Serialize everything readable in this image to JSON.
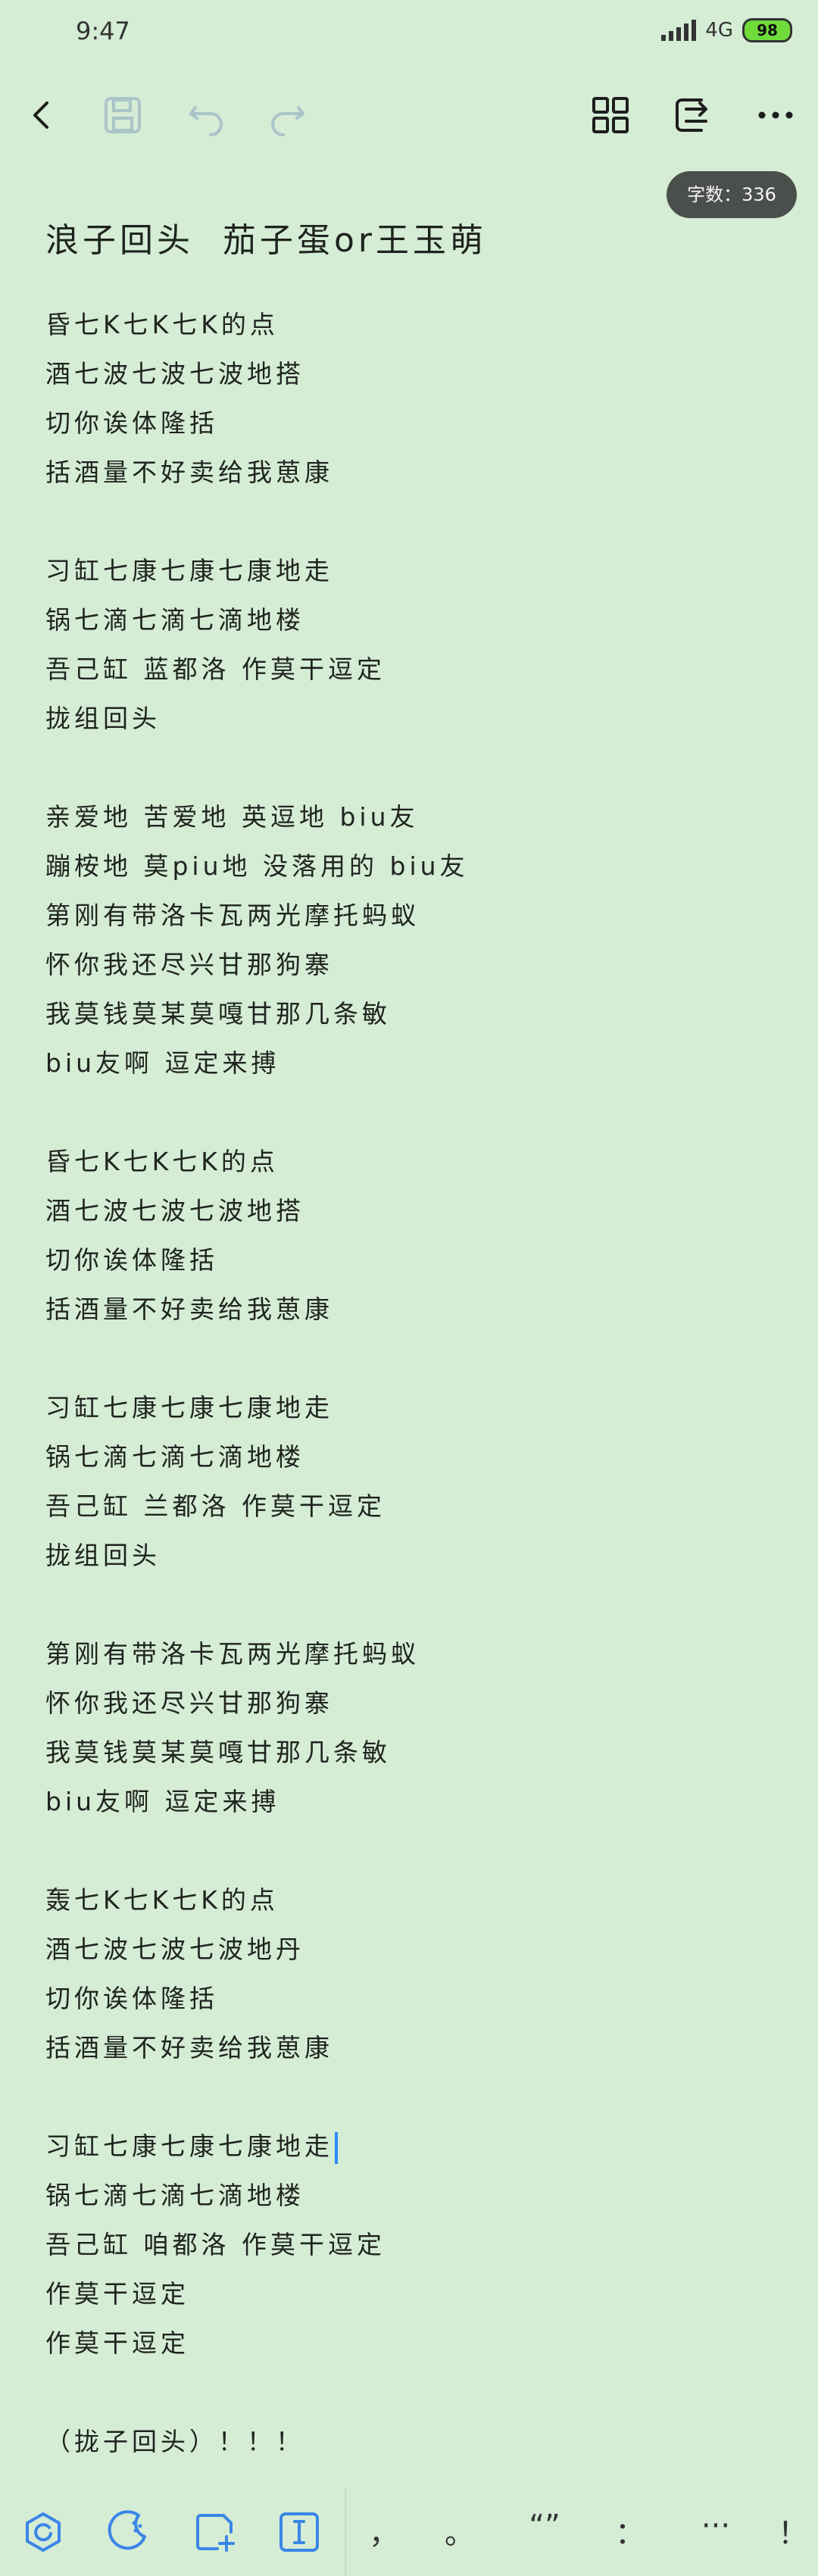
{
  "status_bar": {
    "time": "9:47",
    "network": "4G",
    "battery": "98"
  },
  "toolbar": {
    "icons": [
      "back-arrow-icon",
      "save-icon",
      "undo-icon",
      "redo-icon",
      "grid-view-icon",
      "export-icon",
      "more-icon"
    ]
  },
  "word_count": "字数：336",
  "document": {
    "title": "浪子回头  茄子蛋or王玉萌",
    "lines": [
      "昏七K七K七K的点",
      "酒七波七波七波地搭",
      "切你诶体隆括",
      "括酒量不好卖给我葸康",
      "",
      "习缸七康七康七康地走",
      "锅七滴七滴七滴地楼",
      "吾己缸 蓝都洛 作莫干逗定",
      "拢组回头",
      "",
      "亲爱地 苦爱地 英逗地 biu友",
      "蹦桉地 莫piu地 没落用的 biu友",
      "第刚有带洛卡瓦两光摩托蚂蚁",
      "怀你我还尽兴甘那狗寨",
      "我莫钱莫某莫嘎甘那几条敏",
      "biu友啊 逗定来搏",
      "",
      "昏七K七K七K的点",
      "酒七波七波七波地搭",
      "切你诶体隆括",
      "括酒量不好卖给我葸康",
      "",
      "习缸七康七康七康地走",
      "锅七滴七滴七滴地楼",
      "吾己缸 兰都洛 作莫干逗定",
      "拢组回头",
      "",
      "第刚有带洛卡瓦两光摩托蚂蚁",
      "怀你我还尽兴甘那狗寨",
      "我莫钱莫某莫嘎甘那几条敏",
      "biu友啊 逗定来搏",
      "",
      "轰七K七K七K的点",
      "酒七波七波七波地丹",
      "切你诶体隆括",
      "括酒量不好卖给我葸康",
      "",
      "习缸七康七康七康地走",
      "锅七滴七滴七滴地楼",
      "吾己缸 咱都洛 作莫干逗定",
      "作莫干逗定",
      "作莫干逗定",
      "",
      "（拢子回头）！！！"
    ]
  },
  "bottom_bar": {
    "icons": [
      "assistant-icon",
      "theme-icon",
      "add-note-icon",
      "text-cursor-icon"
    ],
    "punctuation": [
      "，",
      "。",
      "“”",
      "：",
      "···",
      "！"
    ]
  }
}
